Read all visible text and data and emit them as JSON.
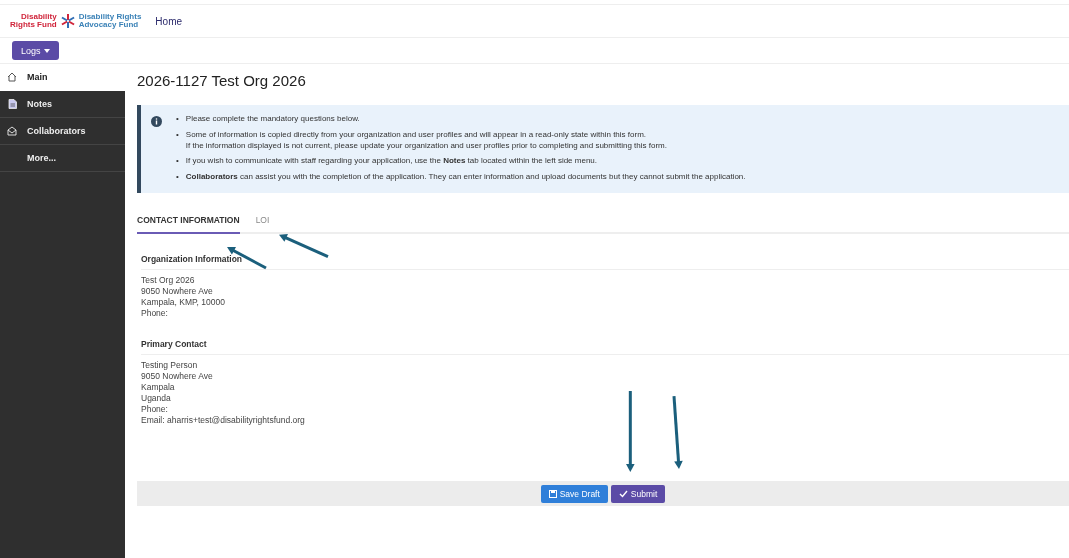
{
  "logo": {
    "left": "Disability\nRights Fund",
    "right": "Disability Rights\nAdvocacy Fund"
  },
  "nav": {
    "home": "Home"
  },
  "logs_button": "Logs",
  "sidebar": {
    "items": [
      {
        "label": "Main",
        "selected": true
      },
      {
        "label": "Notes",
        "selected": false
      },
      {
        "label": "Collaborators",
        "selected": false
      },
      {
        "label": "More...",
        "selected": false
      }
    ]
  },
  "title": "2026-1127 Test Org 2026",
  "info": {
    "bullet": "•",
    "items": [
      [
        "Please complete the mandatory questions below."
      ],
      [
        "Some of information is copied directly from your organization and user profiles and will appear in a read-only state within this form.",
        "If the information displayed is not current, please update your organization and user profiles prior to completing and submitting this form."
      ],
      [
        "If you wish to communicate with staff regarding your application, use the **Notes** tab located within the left side menu."
      ],
      [
        "**Collaborators** can assist you with the completion of the application. They can enter information and upload documents but they cannot submit the application."
      ]
    ]
  },
  "tabs": [
    {
      "label": "CONTACT INFORMATION",
      "selected": true
    },
    {
      "label": "LOI",
      "selected": false
    }
  ],
  "sections": [
    {
      "heading": "Organization Information",
      "lines": [
        "Test Org 2026",
        "9050 Nowhere Ave",
        "Kampala, KMP, 10000",
        "Phone:"
      ]
    },
    {
      "heading": "Primary Contact",
      "lines": [
        "Testing Person",
        "9050 Nowhere Ave",
        "Kampala",
        "Uganda",
        "Phone:",
        "Email: aharris+test@disabilityrightsfund.org"
      ]
    }
  ],
  "buttons": [
    {
      "label": "Save Draft",
      "kind": "draft"
    },
    {
      "label": "Submit",
      "kind": "submit"
    }
  ]
}
